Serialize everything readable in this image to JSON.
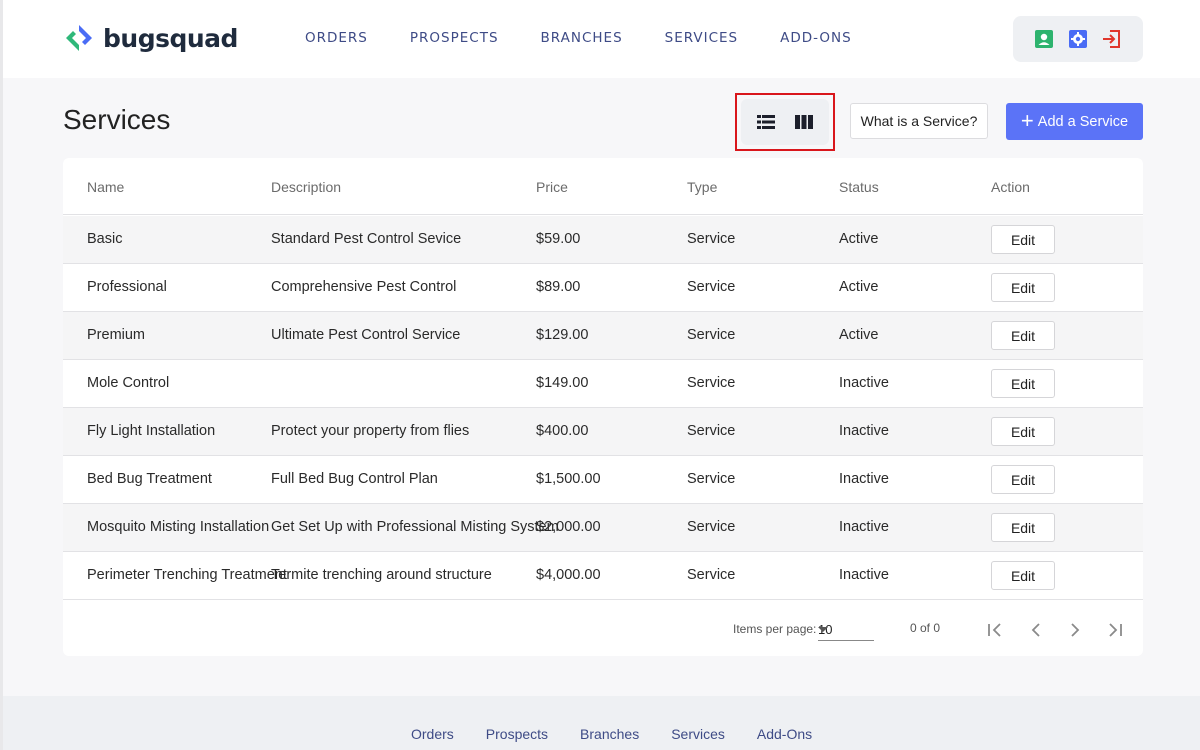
{
  "brand": {
    "name": "bugsquad",
    "logo_colors": [
      "#2fb87a",
      "#4a6cf5"
    ]
  },
  "nav": {
    "items": [
      "ORDERS",
      "PROSPECTS",
      "BRANCHES",
      "SERVICES",
      "ADD-ONS"
    ]
  },
  "header_icons": [
    {
      "name": "profile-icon",
      "color": "#2db36e"
    },
    {
      "name": "settings-icon",
      "color": "#4a6cf5"
    },
    {
      "name": "logout-icon",
      "color": "#e0362c"
    }
  ],
  "page": {
    "title": "Services",
    "what_button": "What is a Service?",
    "add_button": "Add a Service",
    "view_modes": [
      "list-view-icon",
      "column-view-icon"
    ]
  },
  "table": {
    "columns": [
      "Name",
      "Description",
      "Price",
      "Type",
      "Status",
      "Action"
    ],
    "rows": [
      {
        "name": "Basic",
        "description": "Standard Pest Control Sevice",
        "price": "$59.00",
        "type": "Service",
        "status": "Active",
        "action": "Edit"
      },
      {
        "name": "Professional",
        "description": "Comprehensive Pest Control",
        "price": "$89.00",
        "type": "Service",
        "status": "Active",
        "action": "Edit"
      },
      {
        "name": "Premium",
        "description": "Ultimate Pest Control Service",
        "price": "$129.00",
        "type": "Service",
        "status": "Active",
        "action": "Edit"
      },
      {
        "name": "Mole Control",
        "description": "",
        "price": "$149.00",
        "type": "Service",
        "status": "Inactive",
        "action": "Edit"
      },
      {
        "name": "Fly Light Installation",
        "description": "Protect your property from flies",
        "price": "$400.00",
        "type": "Service",
        "status": "Inactive",
        "action": "Edit"
      },
      {
        "name": "Bed Bug Treatment",
        "description": "Full Bed Bug Control Plan",
        "price": "$1,500.00",
        "type": "Service",
        "status": "Inactive",
        "action": "Edit"
      },
      {
        "name": "Mosquito Misting Installation",
        "description": "Get Set Up with Professional Misting System",
        "price": "$2,000.00",
        "type": "Service",
        "status": "Inactive",
        "action": "Edit"
      },
      {
        "name": "Perimeter Trenching Treatment",
        "description": "Termite trenching around structure",
        "price": "$4,000.00",
        "type": "Service",
        "status": "Inactive",
        "action": "Edit"
      }
    ]
  },
  "pager": {
    "items_per_page_label": "Items per page:",
    "items_per_page": "10",
    "range": "0 of 0"
  },
  "footer": {
    "items": [
      "Orders",
      "Prospects",
      "Branches",
      "Services",
      "Add-Ons"
    ]
  }
}
